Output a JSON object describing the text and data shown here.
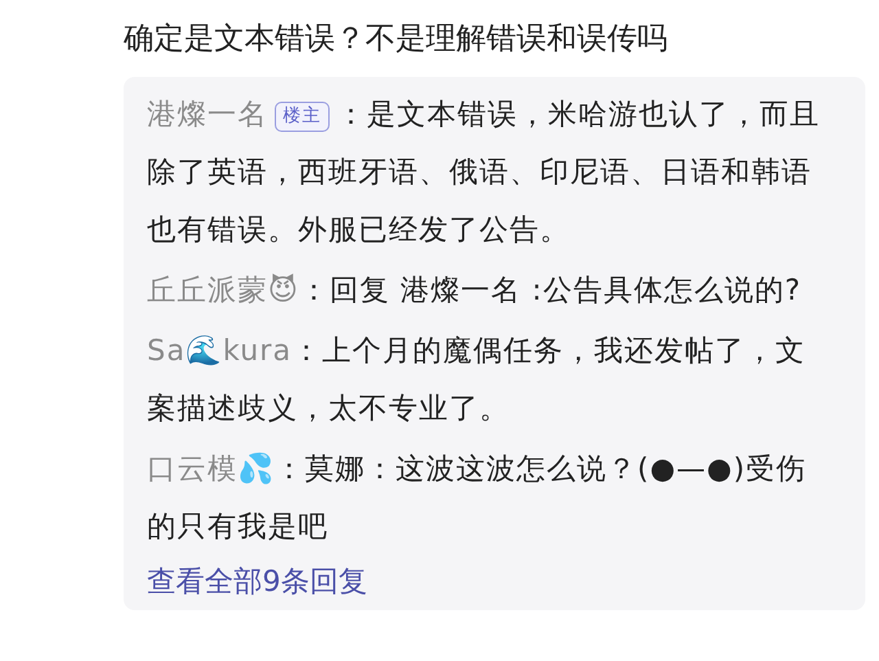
{
  "post": {
    "text": "确定是文本错误？不是理解错误和误传吗"
  },
  "replies": [
    {
      "author": "港燦一名",
      "badge": "楼主",
      "text": "：是文本错误，米哈游也认了，而且除了英语，西班牙语、俄语、印尼语、日语和韩语也有错误。外服已经发了公告。"
    },
    {
      "author": "丘丘派蒙😈",
      "text": "：回复 港燦一名 :公告具体怎么说的?"
    },
    {
      "author": "Sa🌊kura",
      "text": "：上个月的魔偶任务，我还发帖了，文案描述歧义，太不专业了。"
    },
    {
      "author": "口云模💦",
      "text": "：莫娜：这波这波怎么说？(●—●)受伤的只有我是吧"
    }
  ],
  "view_all": "查看全部9条回复"
}
